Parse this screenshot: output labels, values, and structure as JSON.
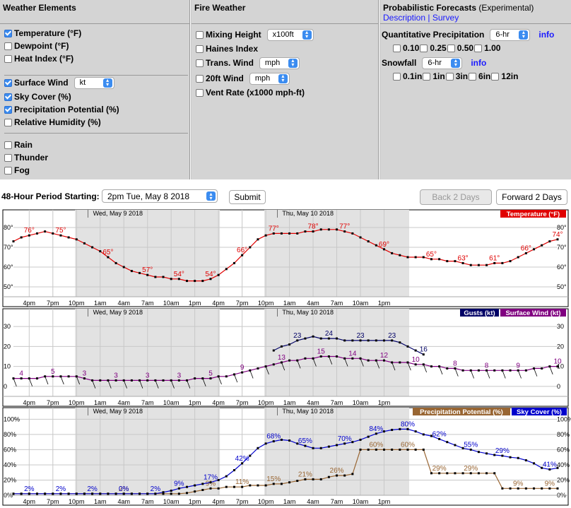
{
  "weather_elements": {
    "title": "Weather Elements",
    "items": [
      {
        "label": "Temperature (°F)",
        "checked": true
      },
      {
        "label": "Dewpoint (°F)",
        "checked": false
      },
      {
        "label": "Heat Index (°F)",
        "checked": false
      },
      {
        "label": "Surface Wind",
        "checked": true,
        "select": "kt"
      },
      {
        "label": "Sky Cover (%)",
        "checked": true
      },
      {
        "label": "Precipitation Potential (%)",
        "checked": true
      },
      {
        "label": "Relative Humidity (%)",
        "checked": false
      },
      {
        "label": "Rain",
        "checked": false
      },
      {
        "label": "Thunder",
        "checked": false
      },
      {
        "label": "Fog",
        "checked": false
      }
    ]
  },
  "fire_weather": {
    "title": "Fire Weather",
    "items": [
      {
        "label": "Mixing Height",
        "checked": false,
        "select": "x100ft"
      },
      {
        "label": "Haines Index",
        "checked": false
      },
      {
        "label": "Trans. Wind",
        "checked": false,
        "select": "mph"
      },
      {
        "label": "20ft Wind",
        "checked": false,
        "select": "mph"
      },
      {
        "label": "Vent Rate (x1000 mph-ft)",
        "checked": false
      }
    ]
  },
  "probabilistic": {
    "title": "Probabilistic Forecasts",
    "title_suffix": "(Experimental)",
    "link_description": "Description",
    "link_sep": "|",
    "link_survey": "Survey",
    "qpf_label": "Quantitative Precipitation",
    "qpf_select": "6-hr",
    "qpf_info": "info",
    "qpf_options": [
      "0.10",
      "0.25",
      "0.50",
      "1.00"
    ],
    "snow_label": "Snowfall",
    "snow_select": "6-hr",
    "snow_info": "info",
    "snow_options": [
      "0.1in",
      "1in",
      "3in",
      "6in",
      "12in"
    ]
  },
  "period": {
    "label": "48-Hour Period Starting:",
    "select": "2pm Tue, May 8 2018",
    "submit": "Submit",
    "back": "Back 2 Days",
    "forward": "Forward 2 Days"
  },
  "x_ticks": [
    "4pm",
    "7pm",
    "10pm",
    "1am",
    "4am",
    "7am",
    "10am",
    "1pm",
    "4pm",
    "7pm",
    "10pm",
    "1am",
    "4am",
    "7am",
    "10am",
    "1pm"
  ],
  "day_labels": [
    "Wed, May 9 2018",
    "Thu, May 10 2018"
  ],
  "colors": {
    "temperature": "#e00000",
    "gusts": "#000066",
    "wind": "#800080",
    "precip": "#996633",
    "sky": "#0000cc"
  },
  "chart_data": [
    {
      "type": "line",
      "title": "Temperature (°F)",
      "x_start": "2pm Tue, May 8 2018",
      "x_interval_hours": 1,
      "ylim": [
        45,
        85
      ],
      "yticks": [
        "50°",
        "60°",
        "70°",
        "80°"
      ],
      "series": [
        {
          "name": "Temperature (°F)",
          "values": [
            73,
            75,
            76,
            77,
            78,
            77,
            76,
            75,
            74,
            72,
            70,
            68,
            65,
            62,
            60,
            58,
            57,
            56,
            55,
            55,
            54,
            54,
            53,
            53,
            53,
            54,
            56,
            59,
            62,
            66,
            70,
            74,
            76,
            77,
            77,
            77,
            77,
            78,
            78,
            79,
            79,
            79,
            78,
            77,
            75,
            73,
            71,
            69,
            67,
            66,
            65,
            65,
            65,
            64,
            64,
            63,
            63,
            62,
            61,
            61,
            61,
            62,
            62,
            63,
            65,
            67,
            69,
            71,
            73,
            74
          ],
          "labels": [
            {
              "i": 2,
              "text": "76°"
            },
            {
              "i": 6,
              "text": "75°"
            },
            {
              "i": 12,
              "text": "65°"
            },
            {
              "i": 17,
              "text": "57°"
            },
            {
              "i": 21,
              "text": "54°"
            },
            {
              "i": 25,
              "text": "54°"
            },
            {
              "i": 29,
              "text": "66°"
            },
            {
              "i": 33,
              "text": "77°"
            },
            {
              "i": 38,
              "text": "78°"
            },
            {
              "i": 42,
              "text": "77°"
            },
            {
              "i": 47,
              "text": "69°"
            },
            {
              "i": 53,
              "text": "65°"
            },
            {
              "i": 57,
              "text": "63°"
            },
            {
              "i": 61,
              "text": "61°"
            },
            {
              "i": 65,
              "text": "66°"
            },
            {
              "i": 69,
              "text": "74°"
            }
          ]
        }
      ]
    },
    {
      "type": "line",
      "title": "Surface Wind (kt)",
      "ylim": [
        -5,
        35
      ],
      "yticks": [
        "0",
        "10",
        "20",
        "30"
      ],
      "series": [
        {
          "name": "Gusts (kt)",
          "start_index": 33,
          "values": [
            18,
            20,
            21,
            23,
            24,
            25,
            24,
            24,
            24,
            23,
            23,
            23,
            23,
            23,
            23,
            23,
            22,
            20,
            18,
            16
          ],
          "labels": [
            {
              "i": 36,
              "text": "23"
            },
            {
              "i": 40,
              "text": "24"
            },
            {
              "i": 44,
              "text": "23"
            },
            {
              "i": 48,
              "text": "23"
            },
            {
              "i": 52,
              "text": "16"
            }
          ]
        },
        {
          "name": "Surface Wind (kt)",
          "values": [
            4,
            4,
            4,
            4,
            5,
            5,
            5,
            5,
            5,
            4,
            3,
            3,
            3,
            3,
            3,
            3,
            3,
            3,
            3,
            3,
            3,
            3,
            3,
            4,
            4,
            4,
            5,
            5,
            6,
            7,
            8,
            9,
            10,
            11,
            12,
            13,
            13,
            14,
            14,
            15,
            15,
            15,
            14,
            14,
            14,
            13,
            13,
            13,
            12,
            12,
            12,
            11,
            11,
            10,
            10,
            9,
            9,
            8,
            8,
            8,
            8,
            8,
            8,
            8,
            8,
            8,
            9,
            9,
            10,
            10
          ],
          "labels": [
            {
              "i": 1,
              "text": "4"
            },
            {
              "i": 5,
              "text": "5"
            },
            {
              "i": 9,
              "text": "3"
            },
            {
              "i": 13,
              "text": "3"
            },
            {
              "i": 17,
              "text": "3"
            },
            {
              "i": 21,
              "text": "3"
            },
            {
              "i": 25,
              "text": "5"
            },
            {
              "i": 29,
              "text": "9"
            },
            {
              "i": 34,
              "text": "13"
            },
            {
              "i": 39,
              "text": "15"
            },
            {
              "i": 43,
              "text": "14"
            },
            {
              "i": 47,
              "text": "12"
            },
            {
              "i": 51,
              "text": "10"
            },
            {
              "i": 56,
              "text": "8"
            },
            {
              "i": 60,
              "text": "8"
            },
            {
              "i": 64,
              "text": "9"
            },
            {
              "i": 69,
              "text": "10"
            }
          ]
        }
      ]
    },
    {
      "type": "line",
      "title": "Sky Cover / Precipitation Potential (%)",
      "ylim": [
        0,
        105
      ],
      "yticks": [
        "0%",
        "20%",
        "40%",
        "60%",
        "80%",
        "100%"
      ],
      "series": [
        {
          "name": "Sky Cover (%)",
          "values": [
            2,
            2,
            2,
            2,
            2,
            2,
            2,
            2,
            2,
            2,
            2,
            2,
            2,
            2,
            2,
            2,
            2,
            2,
            2,
            4,
            6,
            9,
            11,
            13,
            15,
            17,
            20,
            25,
            33,
            42,
            52,
            62,
            68,
            71,
            73,
            72,
            68,
            65,
            62,
            62,
            64,
            66,
            68,
            70,
            73,
            77,
            81,
            84,
            86,
            87,
            87,
            84,
            80,
            78,
            74,
            70,
            66,
            62,
            60,
            57,
            55,
            53,
            52,
            50,
            49,
            46,
            42,
            36,
            34,
            36
          ],
          "labels": [
            {
              "i": 2,
              "text": "2%"
            },
            {
              "i": 6,
              "text": "2%"
            },
            {
              "i": 10,
              "text": "2%"
            },
            {
              "i": 14,
              "text": "0%"
            },
            {
              "i": 18,
              "text": "2%"
            },
            {
              "i": 21,
              "text": "9%"
            },
            {
              "i": 25,
              "text": "17%"
            },
            {
              "i": 29,
              "text": "42%"
            },
            {
              "i": 33,
              "text": "68%"
            },
            {
              "i": 37,
              "text": "65%"
            },
            {
              "i": 42,
              "text": "70%"
            },
            {
              "i": 46,
              "text": "84%"
            },
            {
              "i": 50,
              "text": "80%"
            },
            {
              "i": 54,
              "text": "62%"
            },
            {
              "i": 58,
              "text": "55%"
            },
            {
              "i": 62,
              "text": "29%"
            },
            {
              "i": 68,
              "text": "41%"
            }
          ]
        },
        {
          "name": "Precipitation Potential (%)",
          "values": [
            2,
            2,
            2,
            2,
            2,
            2,
            2,
            2,
            2,
            2,
            2,
            2,
            2,
            2,
            2,
            2,
            2,
            2,
            2,
            2,
            2,
            2,
            3,
            5,
            7,
            9,
            9,
            11,
            11,
            11,
            13,
            13,
            13,
            15,
            15,
            17,
            19,
            21,
            21,
            21,
            24,
            26,
            26,
            28,
            60,
            60,
            60,
            60,
            60,
            60,
            60,
            60,
            60,
            29,
            29,
            29,
            29,
            29,
            29,
            29,
            29,
            29,
            9,
            9,
            9,
            9,
            9,
            9,
            9,
            9
          ],
          "labels": [
            {
              "i": 14,
              "text": "2%"
            },
            {
              "i": 25,
              "text": "9%"
            },
            {
              "i": 29,
              "text": "11%"
            },
            {
              "i": 33,
              "text": "15%"
            },
            {
              "i": 37,
              "text": "21%"
            },
            {
              "i": 41,
              "text": "26%"
            },
            {
              "i": 46,
              "text": "60%"
            },
            {
              "i": 50,
              "text": "60%"
            },
            {
              "i": 54,
              "text": "29%"
            },
            {
              "i": 58,
              "text": "29%"
            },
            {
              "i": 64,
              "text": "9%"
            },
            {
              "i": 68,
              "text": "9%"
            }
          ]
        }
      ]
    }
  ]
}
